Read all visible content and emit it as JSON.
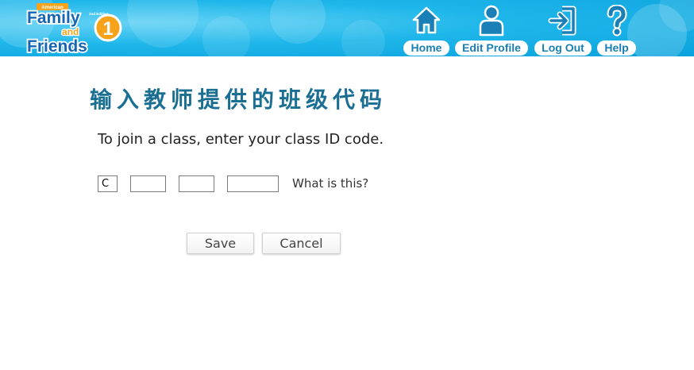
{
  "header": {
    "logo": {
      "top_text": "American",
      "line1": "Family",
      "line2": "and",
      "line3": "Friends",
      "edition": "2nd Edition",
      "level": "1"
    },
    "nav": [
      {
        "label": "Home",
        "icon": "home-icon"
      },
      {
        "label": "Edit Profile",
        "icon": "user-icon"
      },
      {
        "label": "Log Out",
        "icon": "logout-icon"
      },
      {
        "label": "Help",
        "icon": "question-icon"
      }
    ],
    "colors": {
      "header_bg": "#1fb7ea",
      "nav_text": "#1a7fb6",
      "logo_blue": "#1565b3",
      "logo_orange": "#f7a21b"
    }
  },
  "main": {
    "title": "输入教师提供的班级代码",
    "instruction": "To join a class, enter your class ID code.",
    "code_fields": [
      {
        "value": "C"
      },
      {
        "value": ""
      },
      {
        "value": ""
      },
      {
        "value": ""
      }
    ],
    "help_link": "What is this?",
    "save_label": "Save",
    "cancel_label": "Cancel",
    "colors": {
      "title": "#1a6f93"
    }
  }
}
